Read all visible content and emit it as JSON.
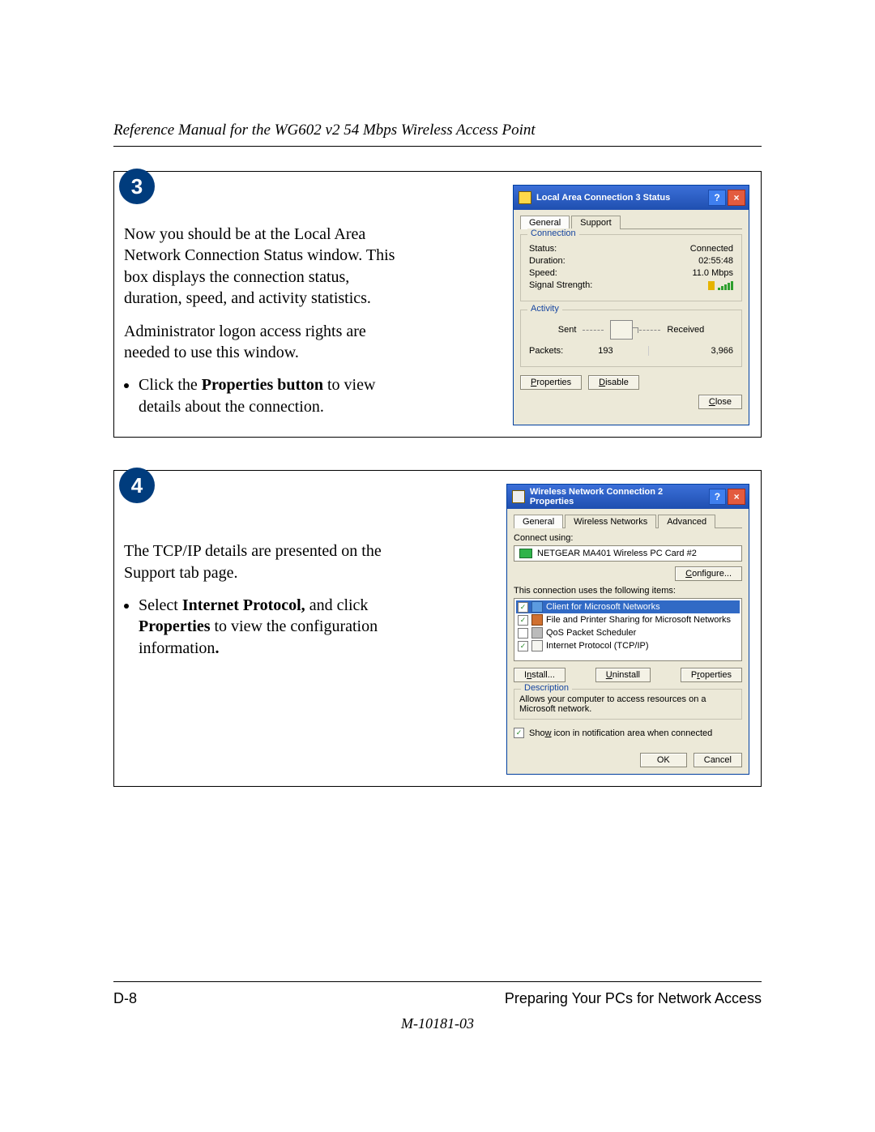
{
  "header": "Reference Manual for the WG602 v2 54 Mbps Wireless Access Point",
  "step3": {
    "num": "3",
    "p1": "Now you should be at the Local Area Network Connection Status window. This box displays the connection status, duration, speed, and activity statistics.",
    "p2": "Administrator logon access rights are needed to use this window.",
    "b1_pre": "Click the ",
    "b1_bold": "Properties button",
    "b1_post": " to view details about the connection."
  },
  "statusWin": {
    "title": "Local Area Connection 3 Status",
    "tab_general": "General",
    "tab_support": "Support",
    "grp_conn": "Connection",
    "k_status": "Status:",
    "v_status": "Connected",
    "k_duration": "Duration:",
    "v_duration": "02:55:48",
    "k_speed": "Speed:",
    "v_speed": "11.0 Mbps",
    "k_signal": "Signal Strength:",
    "grp_act": "Activity",
    "sent": "Sent",
    "received": "Received",
    "k_packets": "Packets:",
    "v_sent": "193",
    "v_recv": "3,966",
    "btn_props": "Properties",
    "btn_disable": "Disable",
    "btn_close": "Close"
  },
  "step4": {
    "num": "4",
    "p1": "The TCP/IP details are presented on the Support tab page.",
    "b1_pre": "Select ",
    "b1_bold1": "Internet Protocol,",
    "b1_mid": " and click ",
    "b1_bold2": "Properties",
    "b1_post": " to view the configuration information",
    "b1_dot": "."
  },
  "propWin": {
    "title": "Wireless Network Connection 2 Properties",
    "tab_general": "General",
    "tab_wnet": "Wireless Networks",
    "tab_adv": "Advanced",
    "connect_using": "Connect using:",
    "adapter": "NETGEAR MA401 Wireless PC Card #2",
    "btn_configure": "Configure...",
    "uses_items": "This connection uses the following items:",
    "item1": "Client for Microsoft Networks",
    "item2": "File and Printer Sharing for Microsoft Networks",
    "item3": "QoS Packet Scheduler",
    "item4": "Internet Protocol (TCP/IP)",
    "btn_install": "Install...",
    "btn_uninstall": "Uninstall",
    "btn_props": "Properties",
    "grp_desc": "Description",
    "desc_text": "Allows your computer to access resources on a Microsoft network.",
    "show_icon": "Show icon in notification area when connected",
    "btn_ok": "OK",
    "btn_cancel": "Cancel"
  },
  "footer": {
    "left": "D-8",
    "right": "Preparing Your PCs for Network Access",
    "doc": "M-10181-03"
  }
}
